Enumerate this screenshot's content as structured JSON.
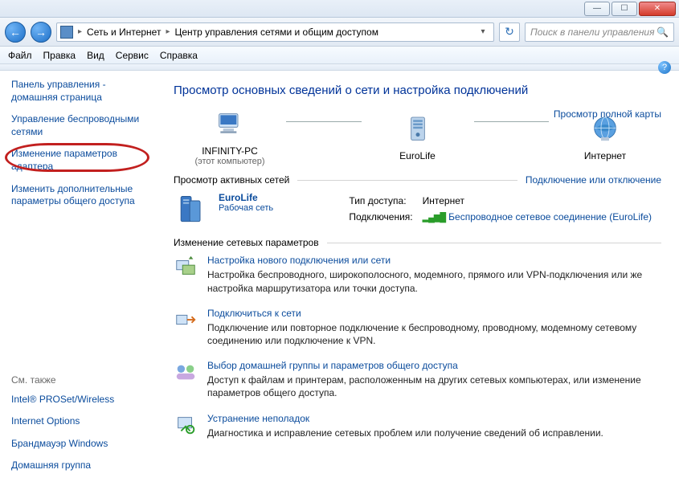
{
  "window": {
    "min": "—",
    "max": "☐",
    "close": "✕"
  },
  "nav": {
    "back": "←",
    "fwd": "→",
    "crumb1": "Сеть и Интернет",
    "crumb2": "Центр управления сетями и общим доступом",
    "refresh": "↻",
    "search_placeholder": "Поиск в панели управления"
  },
  "menu": {
    "file": "Файл",
    "edit": "Правка",
    "view": "Вид",
    "tools": "Сервис",
    "help": "Справка"
  },
  "sidebar": {
    "home": "Панель управления - домашняя страница",
    "wireless": "Управление беспроводными сетями",
    "adapter": "Изменение параметров адаптера",
    "sharing": "Изменить дополнительные параметры общего доступа",
    "seealso": "См. также",
    "s1": "Intel® PROSet/Wireless",
    "s2": "Internet Options",
    "s3": "Брандмауэр Windows",
    "s4": "Домашняя группа"
  },
  "main": {
    "heading": "Просмотр основных сведений о сети и настройка подключений",
    "fullmap": "Просмотр полной карты",
    "node1": "INFINITY-PC",
    "node1sub": "(этот компьютер)",
    "node2": "EuroLife",
    "node3": "Интернет",
    "active_hdr": "Просмотр активных сетей",
    "active_link": "Подключение или отключение",
    "net_name": "EuroLife",
    "net_cat": "Рабочая сеть",
    "access_lbl": "Тип доступа:",
    "access_val": "Интернет",
    "conn_lbl": "Подключения:",
    "conn_val": "Беспроводное сетевое соединение (EuroLife)",
    "settings_hdr": "Изменение сетевых параметров",
    "task1_t": "Настройка нового подключения или сети",
    "task1_d": "Настройка беспроводного, широкополосного, модемного, прямого или VPN-подключения или же настройка маршрутизатора или точки доступа.",
    "task2_t": "Подключиться к сети",
    "task2_d": "Подключение или повторное подключение к беспроводному, проводному, модемному сетевому соединению или подключение к VPN.",
    "task3_t": "Выбор домашней группы и параметров общего доступа",
    "task3_d": "Доступ к файлам и принтерам, расположенным на других сетевых компьютерах, или изменение параметров общего доступа.",
    "task4_t": "Устранение неполадок",
    "task4_d": "Диагностика и исправление сетевых проблем или получение сведений об исправлении."
  }
}
